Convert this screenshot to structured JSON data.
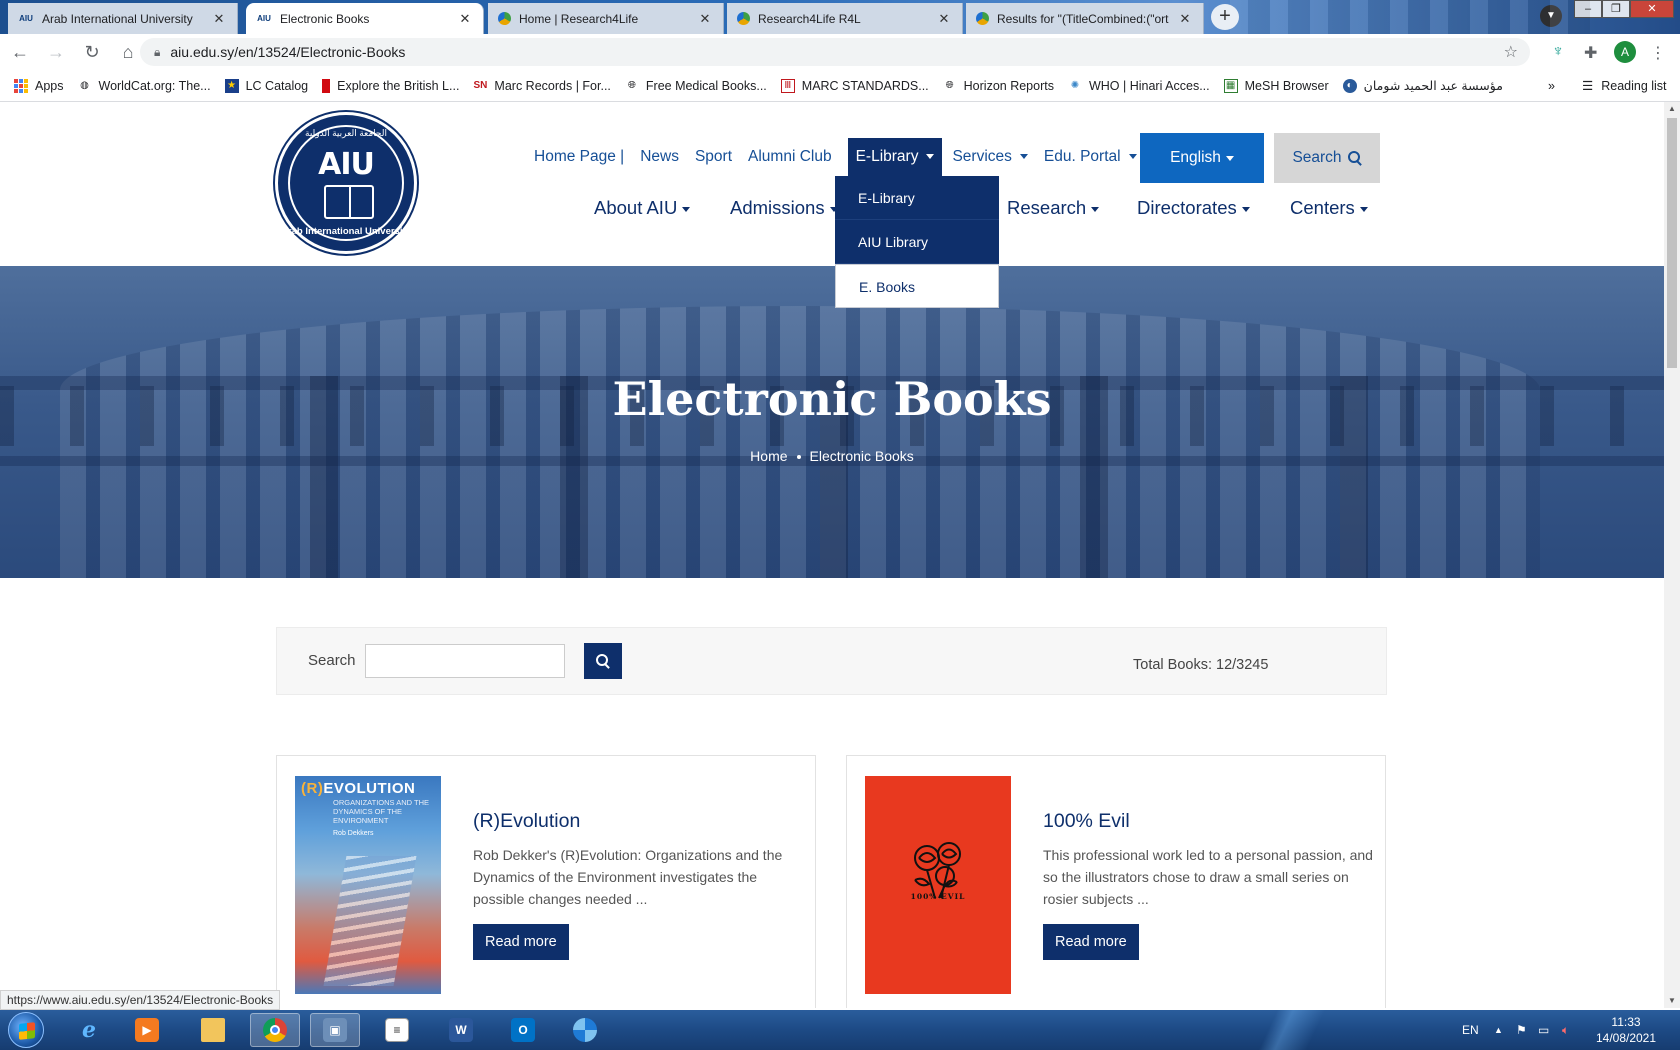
{
  "browser": {
    "tabs": [
      {
        "favicon": "AIU",
        "label": "Arab International University",
        "active": false
      },
      {
        "favicon": "AIU",
        "label": "Electronic Books",
        "active": true
      },
      {
        "favicon": "r4l",
        "label": "Home | Research4Life",
        "active": false
      },
      {
        "favicon": "r4l",
        "label": "Research4Life R4L",
        "active": false
      },
      {
        "favicon": "r4l",
        "label": "Results for \"(TitleCombined:(\"ort",
        "active": false
      }
    ],
    "url": "aiu.edu.sy/en/13524/Electronic-Books",
    "profile_initial": "A",
    "bookmarks": [
      {
        "icon": "apps-grid-icon",
        "label": "Apps"
      },
      {
        "icon": "worldcat-icon",
        "label": "WorldCat.org: The..."
      },
      {
        "icon": "lc-icon",
        "label": "LC Catalog"
      },
      {
        "icon": "british-library-icon",
        "label": "Explore the British L..."
      },
      {
        "icon": "sn-icon",
        "label": "Marc Records | For..."
      },
      {
        "icon": "globe-icon",
        "label": "Free Medical Books..."
      },
      {
        "icon": "marc-icon",
        "label": "MARC STANDARDS..."
      },
      {
        "icon": "globe-icon",
        "label": "Horizon Reports"
      },
      {
        "icon": "who-icon",
        "label": "WHO | Hinari Acces..."
      },
      {
        "icon": "mesh-icon",
        "label": "MeSH Browser"
      },
      {
        "icon": "foundation-icon",
        "label": "مؤسسة عبد الحميد شومان"
      }
    ],
    "reading_list": "Reading list",
    "status_url": "https://www.aiu.edu.sy/en/13524/Electronic-Books"
  },
  "site": {
    "logo": {
      "text": "AIU",
      "arabic": "الجامعة العربية الدولية",
      "english": "Arab International University"
    },
    "top_nav": [
      {
        "label": "Home Page |",
        "caret": false
      },
      {
        "label": "News",
        "caret": false
      },
      {
        "label": "Sport",
        "caret": false
      },
      {
        "label": "Alumni Club",
        "caret": false
      },
      {
        "label": "E-Library",
        "caret": true,
        "active": true
      },
      {
        "label": "Services",
        "caret": true
      },
      {
        "label": "Edu. Portal",
        "caret": true
      }
    ],
    "language_button": "English",
    "search_button": "Search",
    "main_nav": [
      {
        "label": "About AIU"
      },
      {
        "label": "Admissions"
      },
      {
        "label": "Research"
      },
      {
        "label": "Directorates"
      },
      {
        "label": "Centers"
      }
    ],
    "elibrary_dropdown": [
      {
        "label": "E-Library",
        "hover": false
      },
      {
        "label": "AIU Library",
        "hover": false
      },
      {
        "label": "E. Books",
        "hover": true
      }
    ]
  },
  "hero": {
    "title": "Electronic Books",
    "breadcrumb": [
      "Home",
      "Electronic Books"
    ]
  },
  "search": {
    "label": "Search",
    "value": "",
    "total_books": "Total Books: 12/3245"
  },
  "books": [
    {
      "title": "(R)Evolution",
      "description": "Rob Dekker's (R)Evolution: Organizations and the Dynamics of the Environment investigates the possible changes needed ...",
      "read_more": "Read more",
      "cover": {
        "title_prefix": "(R)",
        "title_rest": "EVOLUTION",
        "subtitle": "ORGANIZATIONS AND THE DYNAMICS OF THE ENVIRONMENT",
        "author": "Rob Dekkers"
      }
    },
    {
      "title": "100% Evil",
      "description": "This professional work led to a personal passion, and so the illustrators chose to draw a small series on rosier subjects ...",
      "read_more": "Read more",
      "cover": {
        "title": "100% EVIL"
      }
    }
  ],
  "taskbar": {
    "items": [
      {
        "icon": "internet-explorer-icon",
        "active": false
      },
      {
        "icon": "media-player-icon",
        "active": false
      },
      {
        "icon": "file-explorer-icon",
        "active": false
      },
      {
        "icon": "chrome-icon",
        "active": true
      },
      {
        "icon": "system-tool-icon",
        "active": true
      },
      {
        "icon": "notepad-icon",
        "active": false
      },
      {
        "icon": "word-icon",
        "active": false
      },
      {
        "icon": "outlook-icon",
        "active": false
      },
      {
        "icon": "app-swirl-icon",
        "active": false
      }
    ],
    "language": "EN",
    "time": "11:33",
    "date": "14/08/2021"
  },
  "colors": {
    "brand_navy": "#0e2f6b",
    "link_blue": "#164f96",
    "lang_button_blue": "#0e67c0"
  }
}
